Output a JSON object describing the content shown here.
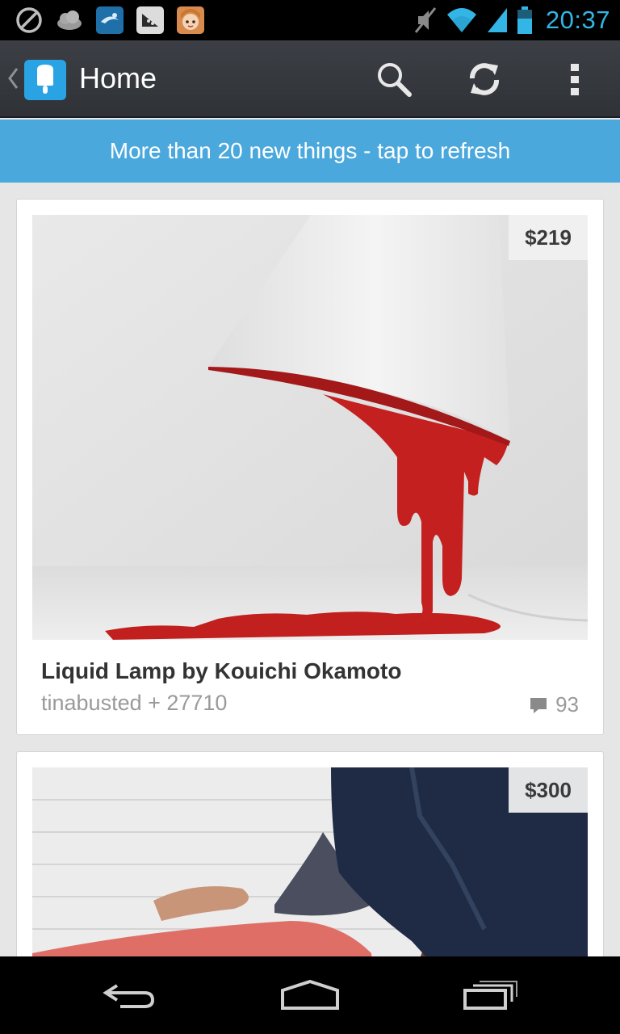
{
  "status_bar": {
    "time": "20:37",
    "left_icons": [
      "blocked-icon",
      "weather-icon",
      "app-icon",
      "message-icon",
      "game-avatar-icon"
    ],
    "right_icons": [
      "mute-icon",
      "wifi-icon",
      "signal-icon",
      "battery-icon"
    ]
  },
  "action_bar": {
    "title": "Home",
    "actions": [
      "search-icon",
      "refresh-icon",
      "overflow-menu-icon"
    ]
  },
  "banner": {
    "text": "More than 20 new things - tap to refresh"
  },
  "feed": {
    "items": [
      {
        "price": "$219",
        "title": "Liquid Lamp by Kouichi Okamoto",
        "meta": "tinabusted + 27710",
        "comments": "93"
      },
      {
        "price": "$300"
      }
    ]
  },
  "nav_bar": {
    "buttons": [
      "back-icon",
      "home-icon",
      "recent-apps-icon"
    ]
  },
  "colors": {
    "accent": "#33b5e5",
    "banner": "#4aa8dd",
    "action_bar": "#34373c",
    "background": "#e6e6e6"
  }
}
